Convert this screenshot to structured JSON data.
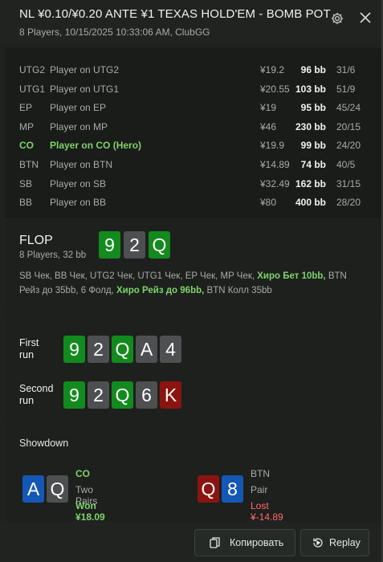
{
  "window": {
    "title": "NL ¥0.10/¥0.20 ANTE ¥1 TEXAS HOLD'EM - BOMB POT",
    "subtitle": "8 Players, 10/15/2025 10:33:06 AM, ClubGG",
    "icons": [
      "gear-icon",
      "close-icon"
    ]
  },
  "players": [
    {
      "pos": "UTG2",
      "name": "Player on UTG2",
      "stack": "¥19.2",
      "bb": "96 bb",
      "stats": "31/6",
      "hero": false
    },
    {
      "pos": "UTG1",
      "name": "Player on UTG1",
      "stack": "¥20.55",
      "bb": "103 bb",
      "stats": "51/9",
      "hero": false
    },
    {
      "pos": "EP",
      "name": "Player on EP",
      "stack": "¥19",
      "bb": "95 bb",
      "stats": "45/24",
      "hero": false
    },
    {
      "pos": "MP",
      "name": "Player on MP",
      "stack": "¥46",
      "bb": "230 bb",
      "stats": "20/15",
      "hero": false
    },
    {
      "pos": "CO",
      "name": "Player on CO (Hero)",
      "stack": "¥19.9",
      "bb": "99 bb",
      "stats": "24/20",
      "hero": true
    },
    {
      "pos": "BTN",
      "name": "Player on BTN",
      "stack": "¥14.89",
      "bb": "74 bb",
      "stats": "40/5",
      "hero": false
    },
    {
      "pos": "SB",
      "name": "Player on SB",
      "stack": "¥32.49",
      "bb": "162 bb",
      "stats": "31/15",
      "hero": false
    },
    {
      "pos": "BB",
      "name": "Player on BB",
      "stack": "¥80",
      "bb": "400 bb",
      "stats": "28/20",
      "hero": false
    }
  ],
  "flop": {
    "heading": "FLOP",
    "sub": "8 Players, 32 bb",
    "cards": [
      {
        "rank": "9",
        "color": "#138a1e"
      },
      {
        "rank": "2",
        "color": "#4d4f50"
      },
      {
        "rank": "Q",
        "color": "#138a1e"
      }
    ],
    "actions_a": "SB Чек, BB Чек, UTG2 Чек, UTG1 Чек, EP Чек, MP Чек, ",
    "actions_hero1": "Хиро Бет 10bb,",
    "actions_b": " BTN Рейз до 35bb, 6 Фолд, ",
    "actions_hero2": "Хиро Рейз до 96bb,",
    "actions_c": " BTN Колл 35bb"
  },
  "runs": [
    {
      "label_1": "First",
      "label_2": "run",
      "cards": [
        {
          "rank": "9",
          "color": "#138a1e"
        },
        {
          "rank": "2",
          "color": "#4d4f50"
        },
        {
          "rank": "Q",
          "color": "#138a1e"
        },
        {
          "rank": "A",
          "color": "#4d4f50"
        },
        {
          "rank": "4",
          "color": "#4d4f50"
        }
      ]
    },
    {
      "label_1": "Second",
      "label_2": "run",
      "cards": [
        {
          "rank": "9",
          "color": "#138a1e"
        },
        {
          "rank": "2",
          "color": "#4d4f50"
        },
        {
          "rank": "Q",
          "color": "#138a1e"
        },
        {
          "rank": "6",
          "color": "#4d4f50"
        },
        {
          "rank": "K",
          "color": "#8c1410"
        }
      ]
    }
  ],
  "showdown": {
    "heading": "Showdown",
    "players": [
      {
        "pos": "CO",
        "hand": "Two Pairs",
        "result": "Won ¥18.09",
        "pos_color": "#7fd36b",
        "result_color": "#7fd36b",
        "cards": [
          {
            "rank": "A",
            "color": "#1557b5"
          },
          {
            "rank": "Q",
            "color": "#4d4f50"
          }
        ]
      },
      {
        "pos": "BTN",
        "hand": "Pair",
        "result": "Lost ¥-14.89",
        "pos_color": "#a8aca8",
        "result_color": "#ff6b6b",
        "cards": [
          {
            "rank": "Q",
            "color": "#8c1410"
          },
          {
            "rank": "8",
            "color": "#1557b5"
          }
        ]
      }
    ]
  },
  "footer": {
    "copy_label": "Копировать",
    "replay_label": "Replay"
  }
}
